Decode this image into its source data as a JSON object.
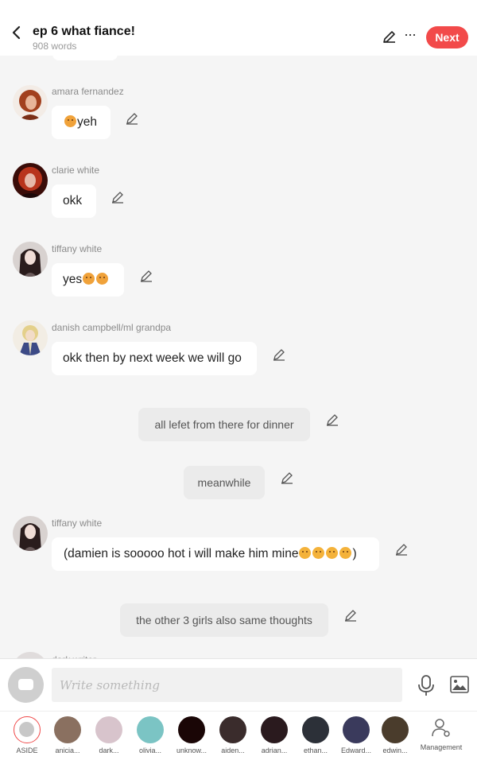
{
  "header": {
    "title": "ep 6 what fiance!",
    "word_count": "908 words",
    "next_label": "Next",
    "more_label": "···",
    "accent_color": "#f24a4a"
  },
  "messages": [
    {
      "type": "character",
      "name": "amara fernandez",
      "text": "yeh",
      "emoji_before": 1,
      "emoji_after": 0
    },
    {
      "type": "character",
      "name": "clarie white",
      "text": "okk",
      "emoji_before": 0,
      "emoji_after": 0
    },
    {
      "type": "character",
      "name": "tiffany white",
      "text": "yes",
      "emoji_before": 0,
      "emoji_after": 2
    },
    {
      "type": "character",
      "name": "danish campbell/ml grandpa",
      "text": "okk then by next week we will go",
      "emoji_before": 0,
      "emoji_after": 0
    },
    {
      "type": "narration",
      "text": "all lefet from there for dinner"
    },
    {
      "type": "narration",
      "text": "meanwhile"
    },
    {
      "type": "character",
      "name": "tiffany white",
      "text": "(damien is sooooo hot i will make him mine",
      "text_end": ")",
      "emoji_before": 0,
      "emoji_after": 4
    },
    {
      "type": "narration",
      "text": "the other 3 girls also same thoughts"
    },
    {
      "type": "character",
      "name": "dark writer",
      "text": ""
    }
  ],
  "composer": {
    "placeholder": "Write something",
    "mic_icon": "microphone-icon",
    "image_icon": "image-icon"
  },
  "characters": [
    {
      "label": "ASIDE",
      "icon": "aside-icon"
    },
    {
      "label": "anicia...",
      "color": "#8a7060"
    },
    {
      "label": "dark...",
      "color": "#d8c4cc"
    },
    {
      "label": "olivia...",
      "color": "#7bc4c4"
    },
    {
      "label": "unknow...",
      "color": "#1a0606"
    },
    {
      "label": "aiden...",
      "color": "#3a2c2c"
    },
    {
      "label": "adrian...",
      "color": "#2a1a1e"
    },
    {
      "label": "ethan...",
      "color": "#2c3038"
    },
    {
      "label": "Edward...",
      "color": "#3a3a5c"
    },
    {
      "label": "edwin...",
      "color": "#4a3c2c"
    }
  ],
  "management_label": "Management"
}
